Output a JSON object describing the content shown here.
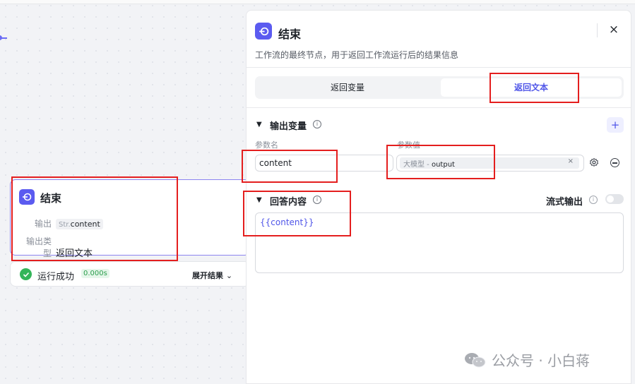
{
  "node": {
    "title": "结束",
    "output_label": "输出",
    "output_type_abbr": "Str.",
    "output_name": "content",
    "output_type_label": "输出类型",
    "output_type_value": "返回文本",
    "status_text": "运行成功",
    "status_time": "0.000s",
    "expand_label": "展开结果"
  },
  "panel": {
    "title": "结束",
    "close": "×",
    "description": "工作流的最终节点，用于返回工作流运行后的结果信息",
    "tabs": [
      {
        "label": "返回变量",
        "active": false
      },
      {
        "label": "返回文本",
        "active": true
      }
    ],
    "output_section": {
      "title": "输出变量",
      "add": "+",
      "col_name": "参数名",
      "col_value": "参数值",
      "param_name": "content",
      "value_source": "大模型",
      "value_sep": " - ",
      "value_output": "output",
      "value_clear": "×"
    },
    "answer_section": {
      "title": "回答内容",
      "stream_label": "流式输出",
      "stream_on": false,
      "content": "{{content}}"
    }
  },
  "watermark": "公众号 · 小白蒋",
  "colors": {
    "accent": "#5b5bf0",
    "highlight": "#e41e1e",
    "success": "#34b559"
  }
}
